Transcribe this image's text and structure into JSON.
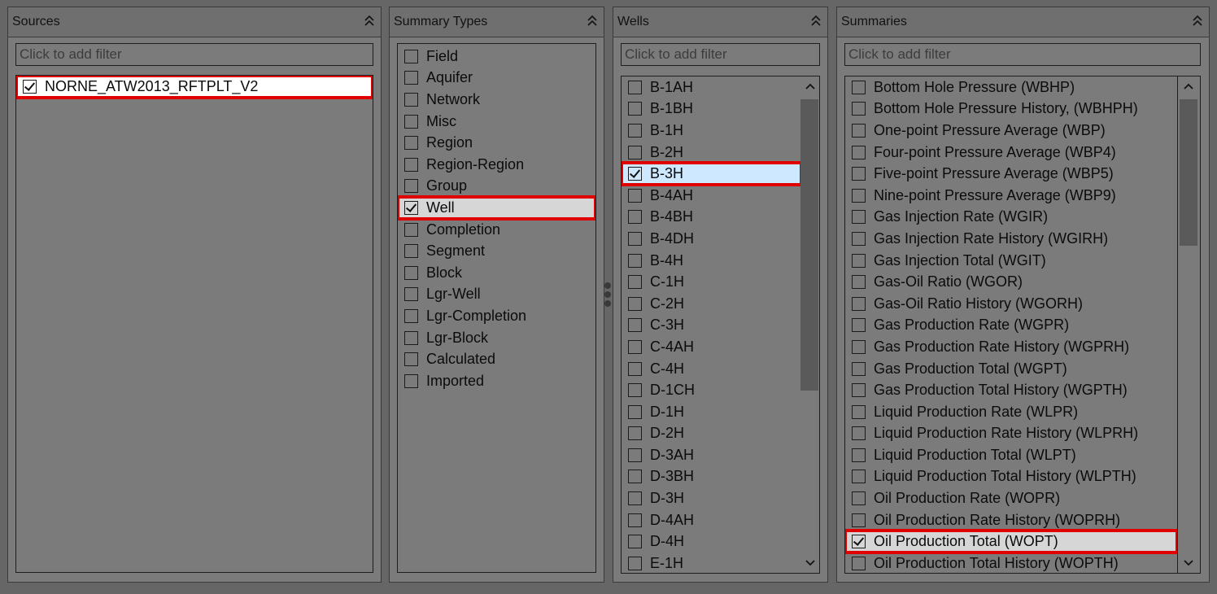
{
  "sources": {
    "title": "Sources",
    "filter_placeholder": "Click to add filter",
    "items": [
      {
        "label": "NORNE_ATW2013_RFTPLT_V2",
        "checked": true
      }
    ]
  },
  "summary_types": {
    "title": "Summary Types",
    "items": [
      {
        "label": "Field",
        "checked": false
      },
      {
        "label": "Aquifer",
        "checked": false
      },
      {
        "label": "Network",
        "checked": false
      },
      {
        "label": "Misc",
        "checked": false
      },
      {
        "label": "Region",
        "checked": false
      },
      {
        "label": "Region-Region",
        "checked": false
      },
      {
        "label": "Group",
        "checked": false
      },
      {
        "label": "Well",
        "checked": true
      },
      {
        "label": "Completion",
        "checked": false
      },
      {
        "label": "Segment",
        "checked": false
      },
      {
        "label": "Block",
        "checked": false
      },
      {
        "label": "Lgr-Well",
        "checked": false
      },
      {
        "label": "Lgr-Completion",
        "checked": false
      },
      {
        "label": "Lgr-Block",
        "checked": false
      },
      {
        "label": "Calculated",
        "checked": false
      },
      {
        "label": "Imported",
        "checked": false
      }
    ]
  },
  "wells": {
    "title": "Wells",
    "filter_placeholder": "Click to add filter",
    "items": [
      {
        "label": "B-1AH",
        "checked": false
      },
      {
        "label": "B-1BH",
        "checked": false
      },
      {
        "label": "B-1H",
        "checked": false
      },
      {
        "label": "B-2H",
        "checked": false
      },
      {
        "label": "B-3H",
        "checked": true
      },
      {
        "label": "B-4AH",
        "checked": false
      },
      {
        "label": "B-4BH",
        "checked": false
      },
      {
        "label": "B-4DH",
        "checked": false
      },
      {
        "label": "B-4H",
        "checked": false
      },
      {
        "label": "C-1H",
        "checked": false
      },
      {
        "label": "C-2H",
        "checked": false
      },
      {
        "label": "C-3H",
        "checked": false
      },
      {
        "label": "C-4AH",
        "checked": false
      },
      {
        "label": "C-4H",
        "checked": false
      },
      {
        "label": "D-1CH",
        "checked": false
      },
      {
        "label": "D-1H",
        "checked": false
      },
      {
        "label": "D-2H",
        "checked": false
      },
      {
        "label": "D-3AH",
        "checked": false
      },
      {
        "label": "D-3BH",
        "checked": false
      },
      {
        "label": "D-3H",
        "checked": false
      },
      {
        "label": "D-4AH",
        "checked": false
      },
      {
        "label": "D-4H",
        "checked": false
      },
      {
        "label": "E-1H",
        "checked": false
      }
    ]
  },
  "summaries": {
    "title": "Summaries",
    "filter_placeholder": "Click to add filter",
    "items": [
      {
        "label": "Bottom Hole Pressure (WBHP)",
        "checked": false
      },
      {
        "label": "Bottom Hole Pressure History, (WBHPH)",
        "checked": false
      },
      {
        "label": "One-point Pressure Average (WBP)",
        "checked": false
      },
      {
        "label": "Four-point Pressure Average (WBP4)",
        "checked": false
      },
      {
        "label": "Five-point Pressure Average (WBP5)",
        "checked": false
      },
      {
        "label": "Nine-point Pressure Average (WBP9)",
        "checked": false
      },
      {
        "label": "Gas Injection Rate (WGIR)",
        "checked": false
      },
      {
        "label": "Gas Injection Rate History (WGIRH)",
        "checked": false
      },
      {
        "label": "Gas Injection Total (WGIT)",
        "checked": false
      },
      {
        "label": "Gas-Oil Ratio (WGOR)",
        "checked": false
      },
      {
        "label": "Gas-Oil Ratio History (WGORH)",
        "checked": false
      },
      {
        "label": "Gas Production Rate (WGPR)",
        "checked": false
      },
      {
        "label": "Gas Production Rate History (WGPRH)",
        "checked": false
      },
      {
        "label": "Gas Production Total (WGPT)",
        "checked": false
      },
      {
        "label": "Gas Production Total History (WGPTH)",
        "checked": false
      },
      {
        "label": "Liquid Production Rate (WLPR)",
        "checked": false
      },
      {
        "label": "Liquid Production Rate History (WLPRH)",
        "checked": false
      },
      {
        "label": "Liquid Production Total (WLPT)",
        "checked": false
      },
      {
        "label": "Liquid Production Total History (WLPTH)",
        "checked": false
      },
      {
        "label": "Oil Production Rate (WOPR)",
        "checked": false
      },
      {
        "label": "Oil Production Rate History (WOPRH)",
        "checked": false
      },
      {
        "label": "Oil Production Total (WOPT)",
        "checked": true
      },
      {
        "label": "Oil Production Total History (WOPTH)",
        "checked": false
      }
    ]
  }
}
